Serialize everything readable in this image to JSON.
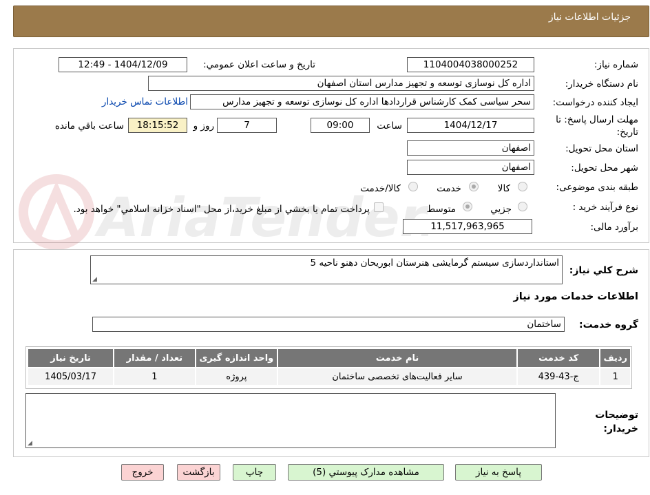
{
  "header": {
    "title": "جزئيات اطلاعات نياز"
  },
  "fields": {
    "need_number_label": "شماره نياز:",
    "need_number": "1104004038000252",
    "announce_label": "تاريخ و ساعت اعلان عمومي:",
    "announce_value": "1404/12/09 - 12:49",
    "buyer_org_label": "نام دستگاه خريدار:",
    "buyer_org": "اداره کل نوسازی  توسعه و تجهیز مدارس استان اصفهان",
    "requester_label": "ايجاد کننده درخواست:",
    "requester": "سحر سیاسی کمک کارشناس قراردادها اداره کل نوسازی  توسعه و تجهیز مدارس",
    "contact_link": "اطلاعات تماس خريدار",
    "deadline_label": "مهلت ارسال پاسخ: تا تاريخ:",
    "deadline_date": "1404/12/17",
    "time_label": "ساعت",
    "deadline_time": "09:00",
    "days_value": "7",
    "days_label": "روز و",
    "remaining_time": "18:15:52",
    "remaining_label": "ساعت باقي مانده",
    "province_label": "استان محل تحويل:",
    "province": "اصفهان",
    "city_label": "شهر محل تحويل:",
    "city": "اصفهان",
    "category_label": "طبقه بندی موضوعی:",
    "category_options": [
      "کالا",
      "خدمت",
      "کالا/خدمت"
    ],
    "category_selected": "خدمت",
    "process_label": "نوع فرآيند خريد :",
    "process_options": [
      "جزيي",
      "متوسط"
    ],
    "process_selected": "متوسط",
    "payment_note": "پرداخت تمام يا بخشي از مبلغ خريد،از محل \"اسناد خزانه اسلامي\" خواهد بود.",
    "budget_label": "برآورد مالی:",
    "budget": "11,517,963,965"
  },
  "description": {
    "label": "شرح کلي نياز:",
    "value": "استانداردسازی سیستم گرمایشی هنرستان ابوریحان دهنو ناحیه 5"
  },
  "services": {
    "section_title": "اطلاعات خدمات مورد نياز",
    "group_label": "گروه خدمت:",
    "group_value": "ساختمان",
    "columns": [
      "رديف",
      "کد خدمت",
      "نام خدمت",
      "واحد اندازه گيری",
      "تعداد / مقدار",
      "تاريخ نياز"
    ],
    "rows": [
      [
        "1",
        "ج-43-439",
        "ساير فعاليت‌های تخصصی ساختمان",
        "پروژه",
        "1",
        "1405/03/17"
      ]
    ]
  },
  "notes": {
    "label": "توضيحات خريدار:"
  },
  "buttons": {
    "reply": "پاسخ به نياز",
    "docs": "مشاهده مدارک پيوستي (5)",
    "print": "چاپ",
    "back": "بازگشت",
    "exit": "خروج"
  },
  "watermark": "AriaTender.net",
  "colors": {
    "header_bg": "#9b7a4b",
    "table_header_bg": "#767676",
    "remaining_bg": "#f9f1c6",
    "button_green": "#d8f5d0",
    "button_pink": "#fbd3d3",
    "link": "#0645ad"
  }
}
